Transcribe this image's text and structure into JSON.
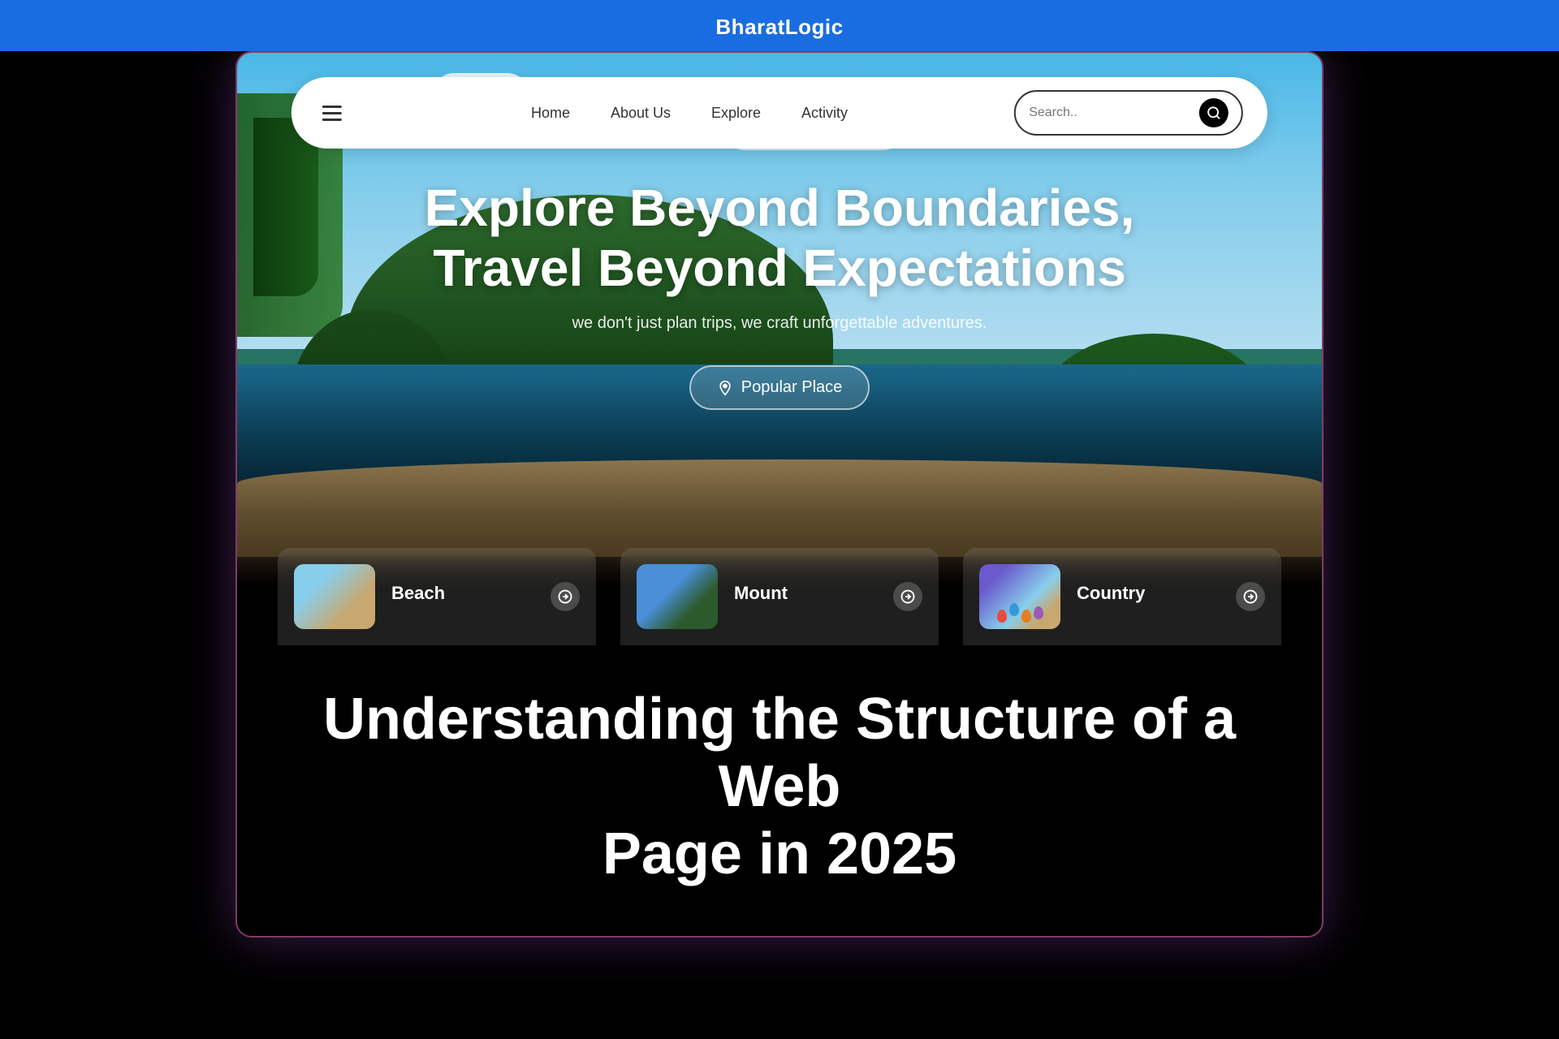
{
  "brand": {
    "name": "BharatLogic"
  },
  "navbar": {
    "hamburger_label": "Menu",
    "links": [
      {
        "id": "home",
        "label": "Home"
      },
      {
        "id": "about",
        "label": "About Us"
      },
      {
        "id": "explore",
        "label": "Explore"
      },
      {
        "id": "activity",
        "label": "Activity"
      }
    ],
    "search_placeholder": "Search..",
    "search_button_label": "Search"
  },
  "hero": {
    "title_line1": "Explore Beyond Boundaries,",
    "title_line2": "Travel Beyond Expectations",
    "subtitle": "we don't just plan trips, we craft unforgettable adventures.",
    "popular_place_label": "Popular Place"
  },
  "cards": [
    {
      "id": "beach",
      "title": "Beach",
      "type": "beach"
    },
    {
      "id": "mount",
      "title": "Mount",
      "type": "mount"
    },
    {
      "id": "country",
      "title": "Country",
      "type": "country"
    }
  ],
  "bottom_caption": {
    "title_line1": "Understanding the Structure of a Web",
    "title_line2": "Page in 2025"
  },
  "icons": {
    "hamburger": "☰",
    "search": "🔍",
    "location_pin": "📍",
    "arrow_right": "→"
  }
}
